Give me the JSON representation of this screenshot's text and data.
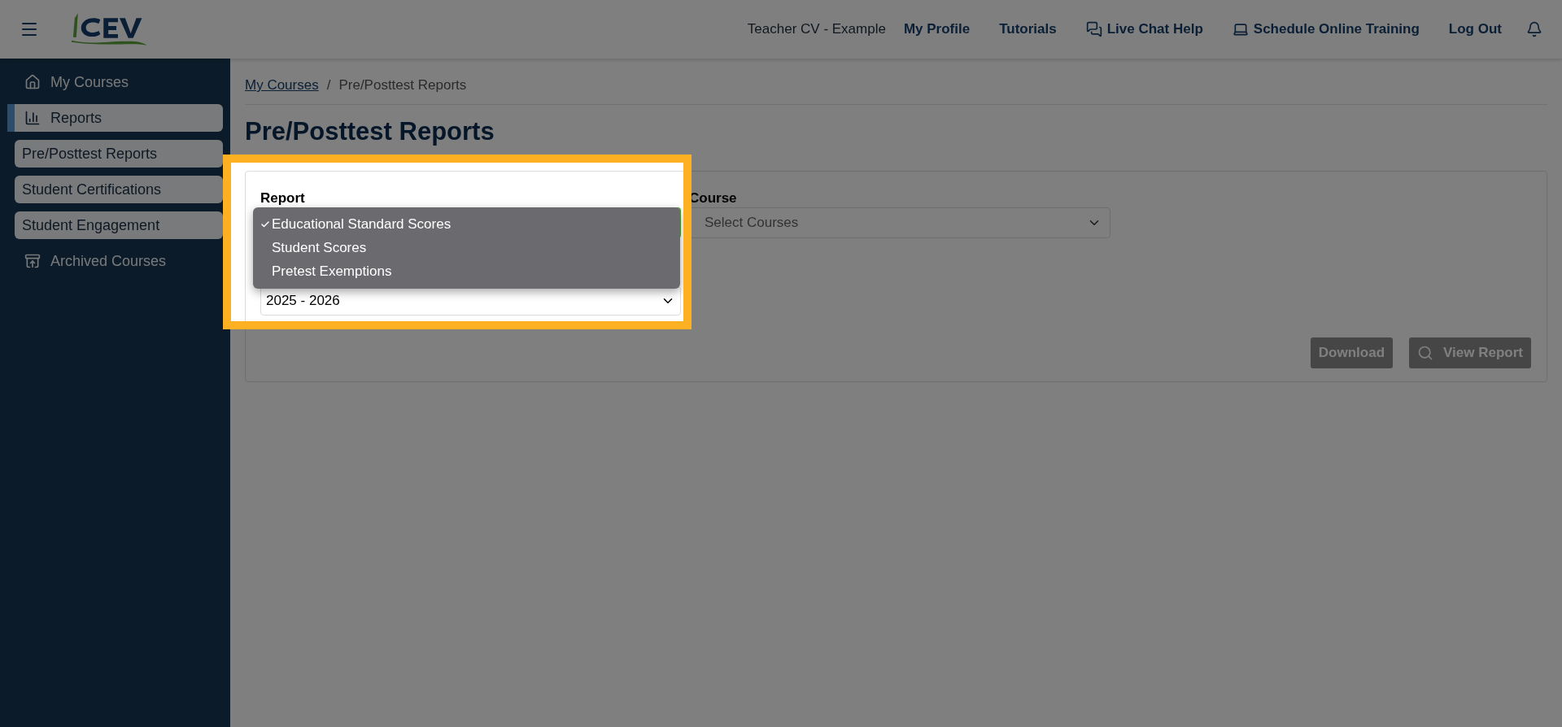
{
  "header": {
    "user": "Teacher CV - Example",
    "links": [
      {
        "label": "My Profile",
        "kind": "text"
      },
      {
        "label": "Tutorials",
        "kind": "text"
      },
      {
        "label": "Live Chat Help",
        "kind": "chat"
      },
      {
        "label": "Schedule Online Training",
        "kind": "laptop"
      },
      {
        "label": "Log Out",
        "kind": "text"
      }
    ]
  },
  "sidebar": {
    "items": [
      {
        "label": "My Courses",
        "kind": "home",
        "selected": false
      },
      {
        "label": "Reports",
        "kind": "chart",
        "selected": true
      },
      {
        "label": "Pre/Posttest Reports",
        "kind": "sub",
        "selected": false
      },
      {
        "label": "Student Certifications",
        "kind": "sub",
        "selected": false
      },
      {
        "label": "Student Engagement",
        "kind": "sub",
        "selected": false
      },
      {
        "label": "Archived Courses",
        "kind": "archive",
        "selected": false
      }
    ]
  },
  "breadcrumb": {
    "link": "My Courses",
    "separator": "/",
    "current": "Pre/Posttest Reports"
  },
  "title": "Pre/Posttest Reports",
  "form": {
    "report_label": "Report",
    "report_menu": [
      {
        "label": "Educational Standard Scores",
        "selected": true
      },
      {
        "label": "Student Scores",
        "selected": false
      },
      {
        "label": "Pretest Exemptions",
        "selected": false
      }
    ],
    "year_value": "2025 - 2026",
    "course_label": "Course",
    "course_placeholder": "Select Courses"
  },
  "buttons": [
    {
      "label": "Download",
      "kind": "plain",
      "disabled": true
    },
    {
      "label": "View Report",
      "kind": "search",
      "disabled": true
    }
  ]
}
